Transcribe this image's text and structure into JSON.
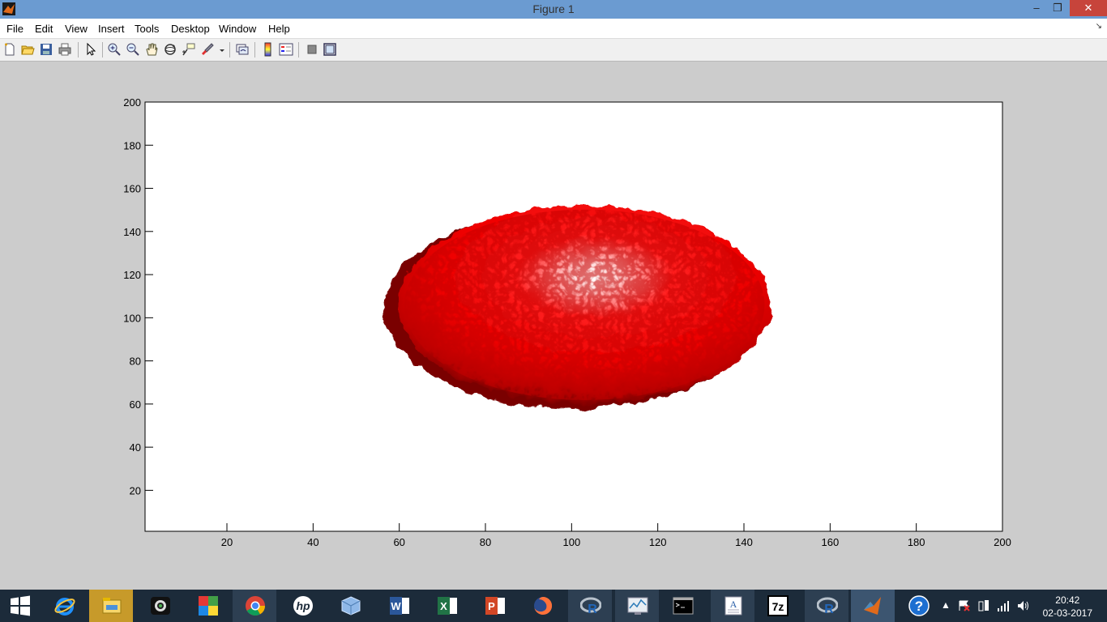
{
  "window": {
    "title": "Figure 1",
    "minimize": "–",
    "restore": "❐",
    "close": "✕"
  },
  "menu": [
    "File",
    "Edit",
    "View",
    "Insert",
    "Tools",
    "Desktop",
    "Window",
    "Help"
  ],
  "menu_dock": "↘",
  "toolbar": {
    "icons": [
      "new-figure-icon",
      "open-file-icon",
      "save-icon",
      "print-icon",
      "edit-plot-icon",
      "zoom-in-icon",
      "zoom-out-icon",
      "pan-hand-icon",
      "rotate-3d-icon",
      "data-cursor-icon",
      "brush-icon",
      "brush-dropdown-icon",
      "link-plot-icon",
      "insert-colorbar-icon",
      "insert-legend-icon",
      "hide-plot-tools-icon",
      "show-plot-tools-icon"
    ]
  },
  "axes": {
    "xticks": [
      "20",
      "40",
      "60",
      "80",
      "100",
      "120",
      "140",
      "160",
      "180",
      "200"
    ],
    "yticks": [
      "20",
      "40",
      "60",
      "80",
      "100",
      "120",
      "140",
      "160",
      "180",
      "200"
    ],
    "xlim": [
      1,
      200
    ],
    "ylim": [
      1,
      200
    ],
    "surface_color": "#ff0000"
  },
  "taskbar": {
    "apps": [
      "windows-start-icon",
      "internet-explorer-icon",
      "file-explorer-icon",
      "webcam-icon",
      "puzzle-app-icon",
      "chrome-icon",
      "hp-icon",
      "virtualbox-icon",
      "word-icon",
      "excel-icon",
      "powerpoint-icon",
      "firefox-icon",
      "r-icon",
      "performance-monitor-icon",
      "command-prompt-icon",
      "document-viewer-icon",
      "7zip-icon",
      "r-studio-icon",
      "matlab-icon",
      "help-icon"
    ],
    "time": "20:42",
    "date": "02-03-2017"
  }
}
